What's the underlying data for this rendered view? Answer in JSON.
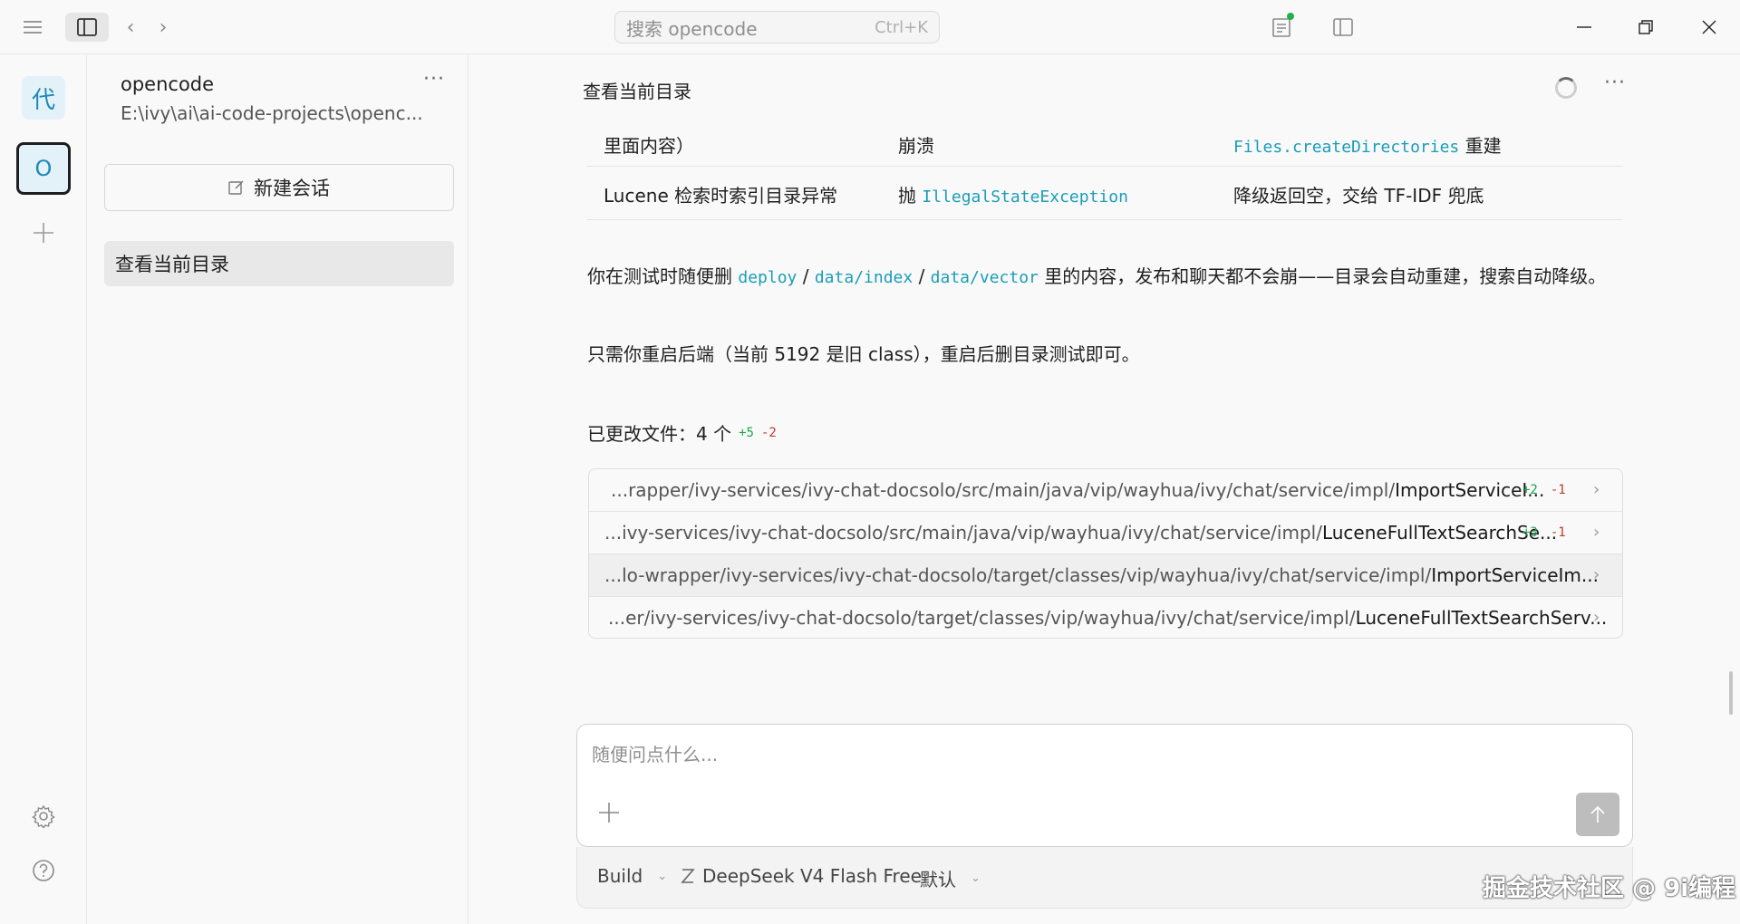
{
  "search": {
    "placeholder": "搜索 opencode",
    "shortcut": "Ctrl+K"
  },
  "rail": {
    "project_letter": "代",
    "session_initial": "O"
  },
  "sidebar": {
    "project_name": "opencode",
    "project_path": "E:\\ivy\\ai\\ai-code-projects\\openc...",
    "new_session_label": "新建会话",
    "sessions": [
      "查看当前目录"
    ]
  },
  "chat": {
    "title": "查看当前目录",
    "table_rows": [
      {
        "col1": "里面内容）",
        "col2": "崩溃",
        "col3_code": "Files.createDirectories",
        "col3_text": " 重建"
      },
      {
        "col1": "Lucene 检索时索引目录异常",
        "col2_prefix": "抛 ",
        "col2_code": "IllegalStateException",
        "col3": "降级返回空，交给 TF-IDF 兜底"
      }
    ],
    "para1": {
      "t1": "你在测试时随便删 ",
      "c1": "deploy",
      "sep1": " / ",
      "c2": "data/index",
      "sep2": " / ",
      "c3": "data/vector",
      "t2": " 里的内容，发布和聊天都不会崩——目录会自动重建，搜索自动降级。"
    },
    "para2": "只需你重启后端（当前 5192 是旧 class），重启后删目录测试即可。",
    "changed": {
      "label": "已更改文件：4 个",
      "added": "+5",
      "removed": "-2"
    },
    "files": [
      {
        "prefix": "...rapper/ivy-services/ivy-chat-docsolo/src/main/java/vip/wayhua/ivy/chat/service/impl/",
        "name": "ImportServiceI...",
        "added": "+2",
        "removed": "-1"
      },
      {
        "prefix": "...ivy-services/ivy-chat-docsolo/src/main/java/vip/wayhua/ivy/chat/service/impl/",
        "name": "LuceneFullTextSearchSe...",
        "added": "+3",
        "removed": "-1"
      },
      {
        "prefix": "...lo-wrapper/ivy-services/ivy-chat-docsolo/target/classes/vip/wayhua/ivy/chat/service/impl/",
        "name": "ImportServiceIm...",
        "added": "",
        "removed": ""
      },
      {
        "prefix": "...er/ivy-services/ivy-chat-docsolo/target/classes/vip/wayhua/ivy/chat/service/impl/",
        "name": "LuceneFullTextSearchServ...",
        "added": "",
        "removed": ""
      }
    ]
  },
  "composer": {
    "placeholder": "随便问点什么...",
    "agent": "Build",
    "model": "DeepSeek V4 Flash Free",
    "variant": "默认"
  },
  "watermark": "掘金技术社区 @ 9i编程"
}
